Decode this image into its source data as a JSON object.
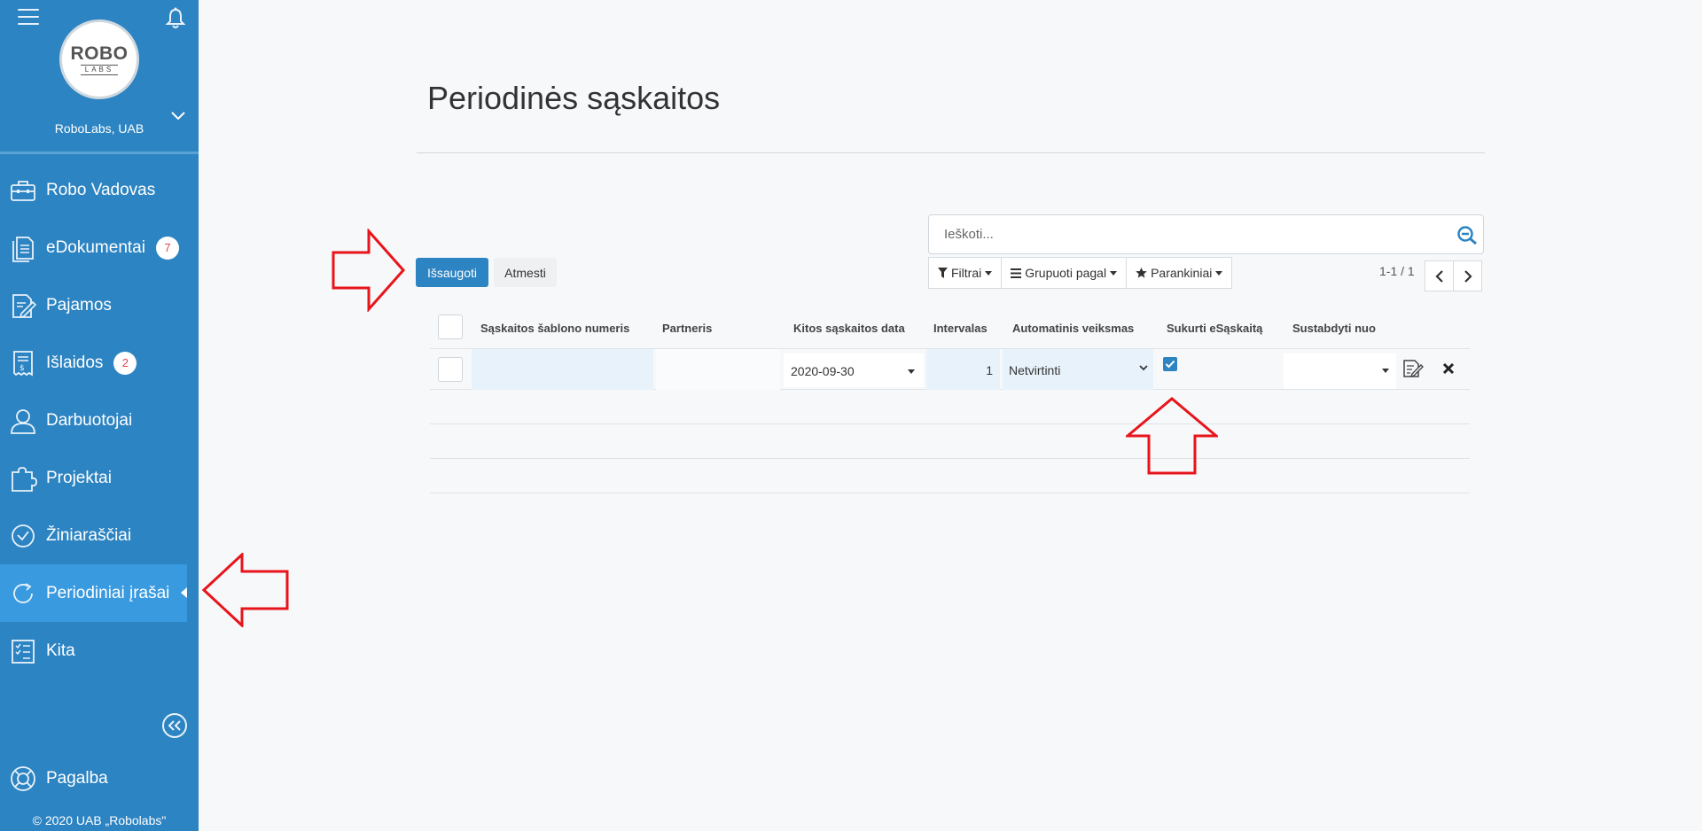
{
  "company": {
    "logo_main": "ROBO",
    "logo_sub": "LABS",
    "name": "RoboLabs, UAB"
  },
  "nav": [
    {
      "label": "Robo Vadovas",
      "icon": "briefcase-icon",
      "badge": ""
    },
    {
      "label": "eDokumentai",
      "icon": "documents-icon",
      "badge": "7"
    },
    {
      "label": "Pajamos",
      "icon": "edit-document-icon",
      "badge": ""
    },
    {
      "label": "Išlaidos",
      "icon": "receipt-icon",
      "badge": "2"
    },
    {
      "label": "Darbuotojai",
      "icon": "user-icon",
      "badge": ""
    },
    {
      "label": "Projektai",
      "icon": "puzzle-icon",
      "badge": ""
    },
    {
      "label": "Žiniaraščiai",
      "icon": "clock-icon",
      "badge": ""
    },
    {
      "label": "Periodiniai įrašai",
      "icon": "refresh-icon",
      "badge": "",
      "active": true
    },
    {
      "label": "Kita",
      "icon": "checklist-icon",
      "badge": ""
    }
  ],
  "help_label": "Pagalba",
  "copyright": "© 2020 UAB „Robolabs\"",
  "page": {
    "title": "Periodinės sąskaitos"
  },
  "search": {
    "placeholder": "Ieškoti..."
  },
  "actions": {
    "save": "Išsaugoti",
    "cancel": "Atmesti"
  },
  "toolbar": {
    "filters": "Filtrai",
    "group_by": "Grupuoti pagal",
    "favorites": "Parankiniai"
  },
  "pager": {
    "text": "1-1 / 1"
  },
  "table": {
    "columns": [
      "Sąskaitos šablono numeris",
      "Partneris",
      "Kitos sąskaitos data",
      "Intervalas",
      "Automatinis veiksmas",
      "Sukurti eSąskaitą",
      "Sustabdyti nuo"
    ],
    "row": {
      "template_number": "",
      "partner": "",
      "next_date": "2020-09-30",
      "interval": "1",
      "action": "Netvirtinti",
      "create_einvoice": true,
      "stop_from": ""
    }
  },
  "colors": {
    "sidebar": "#2d84c2",
    "sidebar_active": "#3a9ae0",
    "primary": "#2d84c2",
    "annotation": "#e8141b"
  }
}
